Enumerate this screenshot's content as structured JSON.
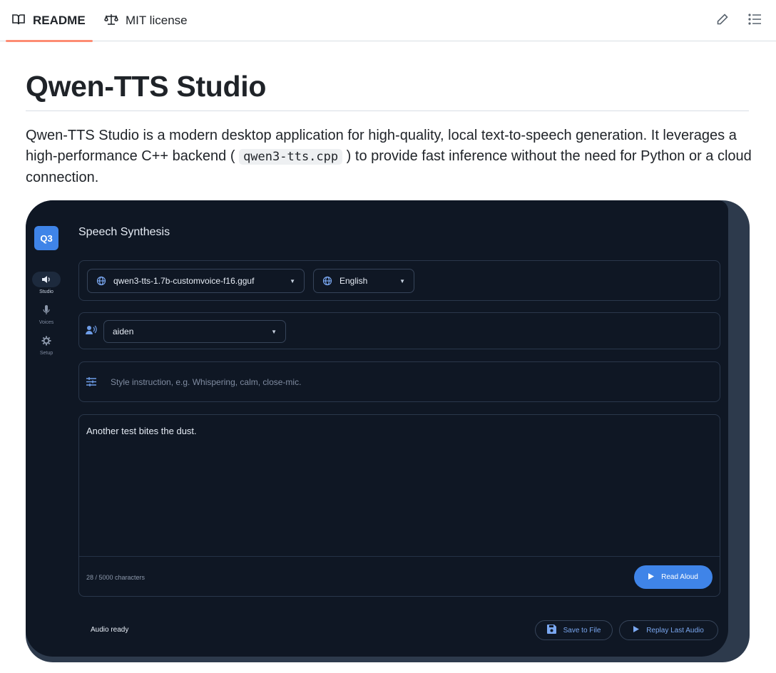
{
  "tabs": {
    "readme_label": "README",
    "license_label": "MIT license"
  },
  "readme": {
    "title": "Qwen-TTS Studio",
    "paragraph_before_code": "Qwen-TTS Studio is a modern desktop application for high-quality, local text-to-speech generation. It leverages a high-performance C++ backend ( ",
    "code": "qwen3-tts.cpp",
    "paragraph_after_code": " ) to provide fast inference without the need for Python or a cloud connection."
  },
  "app": {
    "logo_text": "Q3",
    "title": "Speech Synthesis",
    "nav": [
      {
        "label": "Studio",
        "icon": "speaker-icon"
      },
      {
        "label": "Voices",
        "icon": "microphone-icon"
      },
      {
        "label": "Setup",
        "icon": "gear-icon"
      }
    ],
    "model_select": "qwen3-tts-1.7b-customvoice-f16.gguf",
    "language_select": "English",
    "voice_select": "aiden",
    "style_placeholder": "Style instruction, e.g. Whispering, calm, close-mic.",
    "speech_text": "Another test bites the dust.",
    "char_count": "28 / 5000 characters",
    "read_button": "Read Aloud",
    "status": "Audio ready",
    "save_button": "Save to File",
    "replay_button": "Replay Last Audio"
  },
  "colors": {
    "accent": "#3f84e8",
    "app_background": "#0f1724",
    "tab_underline": "#fd8c73"
  }
}
